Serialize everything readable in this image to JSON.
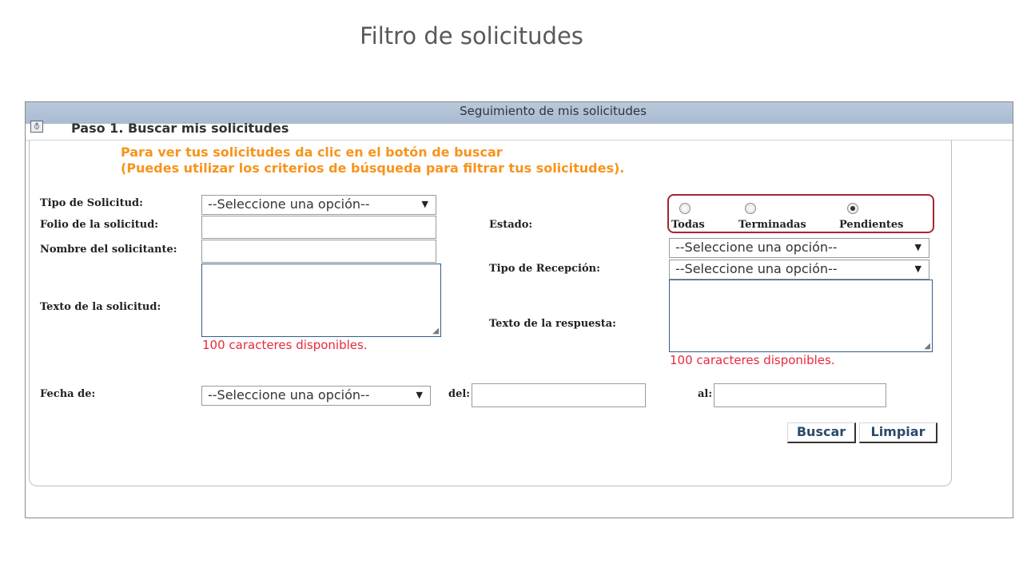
{
  "slide_title": "Filtro de solicitudes",
  "panel": {
    "header_title": "Seguimiento de mis solicitudes",
    "collapse_icon": "⦽",
    "step_title": "Paso 1. Buscar mis solicitudes"
  },
  "instructions": {
    "line1": "Para ver tus solicitudes da clic en el botón de buscar",
    "line2": "(Puedes utilizar los criterios de búsqueda para filtrar tus solicitudes)."
  },
  "labels": {
    "tipo_solicitud": "Tipo de Solicitud:",
    "folio": "Folio de la solicitud:",
    "nombre": "Nombre del solicitante:",
    "texto_solicitud": "Texto de la solicitud:",
    "estado": "Estado:",
    "tipo_recepcion": "Tipo de Recepción:",
    "texto_respuesta": "Texto de la respuesta:",
    "fecha_de": "Fecha de:",
    "del": "del:",
    "al": "al:"
  },
  "selects": {
    "tipo_solicitud": "--Seleccione una opción--",
    "estado": "--Seleccione una opción--",
    "tipo_recepcion": "--Seleccione una opción--",
    "fecha_de": "--Seleccione una opción--"
  },
  "inputs": {
    "folio": "",
    "nombre": "",
    "texto_solicitud": "",
    "texto_respuesta": "",
    "fecha_del": "",
    "fecha_al": ""
  },
  "counters": {
    "solicitud": "100 caracteres disponibles.",
    "respuesta": "100 caracteres disponibles."
  },
  "radios": {
    "options": [
      "Todas",
      "Terminadas",
      "Pendientes"
    ],
    "selected": "Pendientes"
  },
  "buttons": {
    "buscar": "Buscar",
    "limpiar": "Limpiar"
  },
  "colors": {
    "instruction_orange": "#f7941d",
    "counter_red": "#e8293d",
    "highlight_box": "#a6262c",
    "header_blue": "#b9c9dc"
  }
}
